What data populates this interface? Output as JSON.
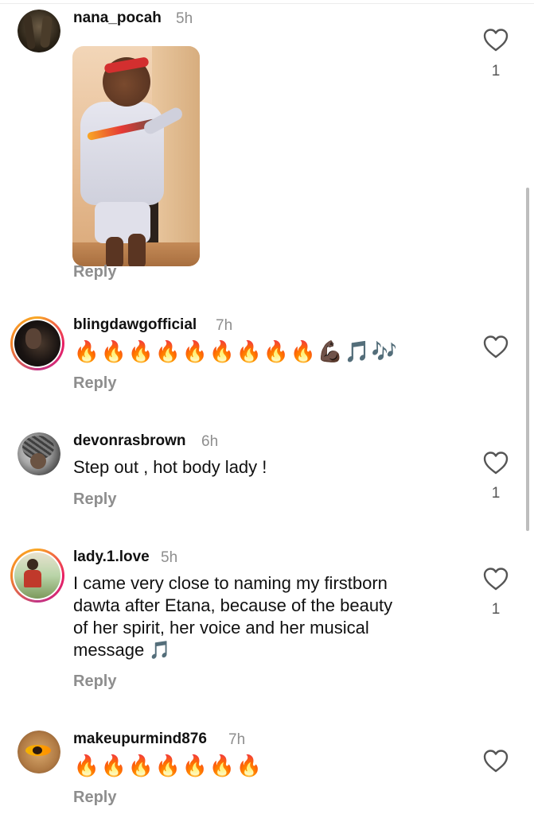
{
  "comments": [
    {
      "username": "nana_pocah",
      "time": "5h",
      "reply": "Reply",
      "likes": "1"
    },
    {
      "username": "blingdawgofficial",
      "time": "7h",
      "text": "🔥🔥🔥🔥🔥🔥🔥🔥🔥💪🏿🎵🎶",
      "emojis": [
        "🔥",
        "🔥",
        "🔥",
        "🔥",
        "🔥",
        "🔥",
        "🔥",
        "🔥",
        "🔥",
        "💪🏿",
        "🎵",
        "🎶"
      ],
      "reply": "Reply"
    },
    {
      "username": "devonrasbrown",
      "time": "6h",
      "text": "Step out , hot body lady !",
      "reply": "Reply",
      "likes": "1"
    },
    {
      "username": "lady.1.love",
      "time": "5h",
      "text_lines": [
        "I came very close to naming my firstborn",
        "dawta after Etana, because of the beauty",
        "of her spirit, her voice and her musical",
        "message 🎵"
      ],
      "reply": "Reply",
      "likes": "1"
    },
    {
      "username": "makeupurmind876",
      "time": "7h",
      "text": "🔥🔥🔥🔥🔥🔥🔥",
      "emojis": [
        "🔥",
        "🔥",
        "🔥",
        "🔥",
        "🔥",
        "🔥",
        "🔥"
      ],
      "reply": "Reply"
    }
  ],
  "icons": {
    "like": "heart-outline-icon"
  },
  "colors": {
    "text": "#111111",
    "muted": "#8e8e8e",
    "story_ring": [
      "#f9a825",
      "#e91e63",
      "#c13584"
    ]
  }
}
